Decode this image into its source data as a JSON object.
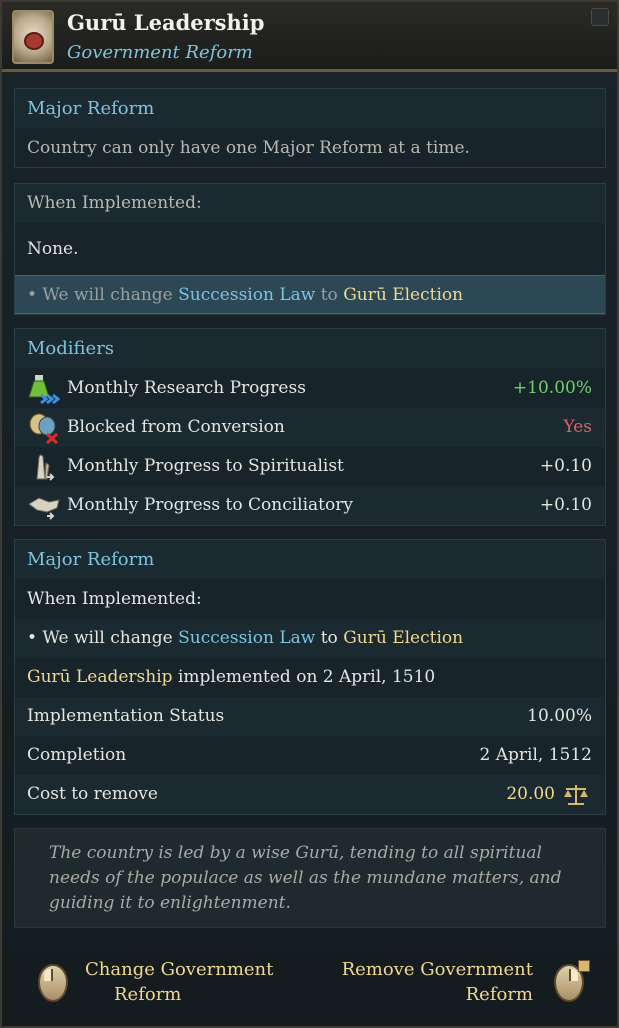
{
  "header": {
    "title": "Gurū Leadership",
    "subtitle": "Government Reform",
    "icon": "scroll-seal-icon"
  },
  "major_reform_box": {
    "title": "Major Reform",
    "text": "Country can only have one Major Reform at a time."
  },
  "when_implemented_box": {
    "title": "When Implemented:",
    "none": "None.",
    "effect": {
      "prefix": "• We will change",
      "law": "Succession Law",
      "to": "to",
      "target": "Gurū Election"
    }
  },
  "modifiers": {
    "title": "Modifiers",
    "items": [
      {
        "label": "Monthly Research Progress",
        "value": "+10.00%",
        "icon": "research-flask-icon",
        "color": "#6fd06a"
      },
      {
        "label": "Blocked from Conversion",
        "value": "Yes",
        "icon": "masks-blocked-icon",
        "color": "#e06060"
      },
      {
        "label": "Monthly Progress to Spiritualist",
        "value": "+0.10",
        "icon": "praying-hands-icon",
        "color": "#e6e6e0"
      },
      {
        "label": "Monthly Progress to Conciliatory",
        "value": "+0.10",
        "icon": "handshake-icon",
        "color": "#e6e6e0"
      }
    ]
  },
  "status_box": {
    "title": "Major Reform",
    "when_implemented": "When Implemented:",
    "effect": {
      "prefix": "• We will change",
      "law": "Succession Law",
      "to": "to",
      "target": "Gurū Election"
    },
    "implemented": {
      "name": "Gurū Leadership",
      "text": "implemented on 2 April, 1510"
    },
    "implementation_status": {
      "label": "Implementation Status",
      "value": "10.00%"
    },
    "completion": {
      "label": "Completion",
      "value": "2 April, 1512"
    },
    "cost_to_remove": {
      "label": "Cost to remove",
      "value": "20.00",
      "icon": "scales-icon"
    }
  },
  "description": "The country is led by a wise Gurū, tending to all spiritual needs of the populace as well as the mundane matters, and guiding it to enlightenment.",
  "footer": {
    "change": {
      "line1": "Change Government",
      "line2": "Reform"
    },
    "remove": {
      "line1": "Remove Government",
      "line2": "Reform"
    }
  }
}
